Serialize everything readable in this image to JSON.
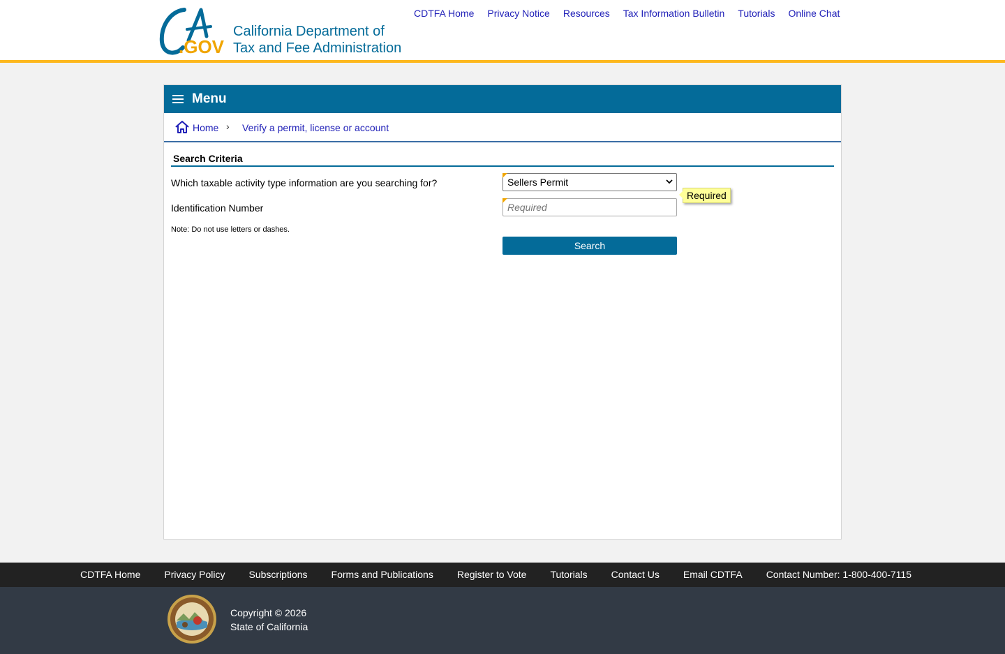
{
  "header": {
    "agency_line1": "California Department of",
    "agency_line2": "Tax and Fee Administration",
    "logo_text_ca": "CA",
    "logo_text_gov": ".GOV",
    "nav": [
      "CDTFA Home",
      "Privacy Notice",
      "Resources",
      "Tax Information Bulletin",
      "Tutorials",
      "Online Chat"
    ]
  },
  "menu": {
    "label": "Menu"
  },
  "breadcrumb": {
    "home": "Home",
    "separator": "›",
    "current": "Verify a permit, license or account"
  },
  "form": {
    "section_title": "Search Criteria",
    "activity_label": "Which taxable activity type information are you searching for?",
    "activity_value": "Sellers Permit",
    "id_label": "Identification Number",
    "id_placeholder": "Required",
    "id_value": "",
    "note": "Note: Do not use letters or dashes.",
    "tooltip": "Required",
    "search_label": "Search"
  },
  "footer": {
    "links": [
      "CDTFA Home",
      "Privacy Policy",
      "Subscriptions",
      "Forms and Publications",
      "Register to Vote",
      "Tutorials",
      "Contact Us",
      "Email CDTFA",
      "Contact Number: 1-800-400-7115"
    ],
    "copyright_line1": "Copyright © 2026",
    "copyright_line2": "State of California"
  },
  "colors": {
    "brand_blue": "#046b99",
    "gold": "#fdb81e",
    "link": "#2121b8",
    "footer_dark": "#222222",
    "footer_slate": "#323a45"
  },
  "icons": {
    "logo": "ca-gov-logo",
    "menu": "hamburger-icon",
    "home": "home-icon",
    "select": "chevron-down-icon",
    "seal": "california-seal-icon"
  }
}
